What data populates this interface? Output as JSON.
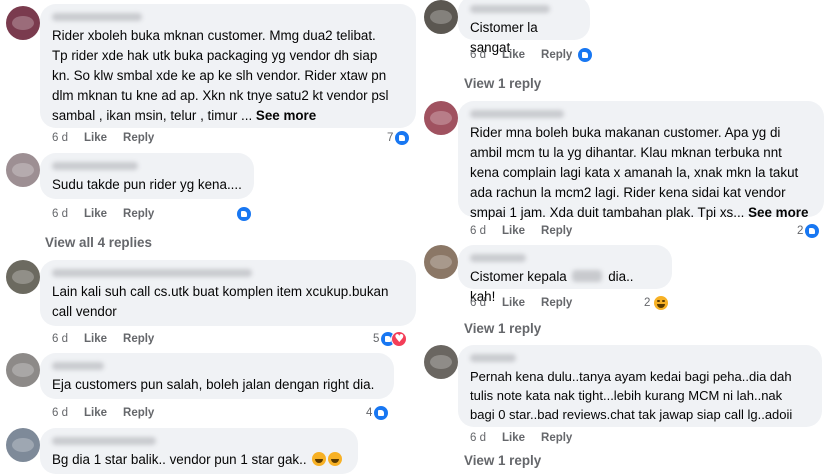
{
  "actions": {
    "time": "6 d",
    "like": "Like",
    "reply": "Reply"
  },
  "left": {
    "c1": {
      "lines": [
        "Rider xboleh buka mknan customer. Mmg dua2 telibat.",
        "Tp rider xde hak utk buka packaging yg vendor dh siap",
        "kn. So klw smbal xde ke ap ke slh vendor. Rider xtaw pn",
        "dlm mknan tu kne ad ap. Xkn nk tnye satu2 kt vendor psl"
      ],
      "last_line": "sambal , ikan msin, telur , timur ... ",
      "see_more": "See more",
      "reactions": "7"
    },
    "c2": {
      "text": "Sudu takde pun rider yg kena....",
      "reactions": ""
    },
    "view_replies": "View all 4 replies",
    "c3": {
      "lines": [
        "Lain kali suh call cs.utk buat komplen item xcukup.bukan",
        "call vendor"
      ],
      "reactions": "5"
    },
    "c4": {
      "text": "Eja customers pun salah, boleh jalan dengan right dia.",
      "reactions": "4"
    },
    "c5": {
      "text": "Bg dia 1 star balik.. vendor pun 1 star gak.."
    }
  },
  "right": {
    "c1": {
      "text": "Cistomer la sangat"
    },
    "view_reply_1": "View 1 reply",
    "c2": {
      "lines": [
        "Rider mna boleh buka makanan customer. Apa yg di",
        "ambil mcm tu la yg dihantar. Klau mknan terbuka nnt",
        "kena complain lagi kata x amanah la, xnak mkn la takut",
        "ada rachun la mcm2 lagi. Rider kena sidai kat vendor"
      ],
      "last_line": "smpai 1 jam. Xda duit tambahan plak. Tpi xs... ",
      "see_more": "See more",
      "reactions": "2"
    },
    "c3": {
      "text_before": "Cistomer kepala",
      "text_after": "dia.. kah!",
      "reactions": "2"
    },
    "view_reply_2": "View 1 reply",
    "c4": {
      "lines": [
        "Pernah kena dulu..tanya ayam kedai bagi peha..dia dah",
        "tulis note kata nak tight...lebih kurang MCM ni lah..nak",
        "bagi 0 star..bad reviews.chat tak jawap siap call lg..adoii"
      ]
    },
    "view_reply_3": "View 1 reply"
  },
  "colors": {
    "bubble": "#f0f2f5",
    "muted": "#65676b",
    "like_blue": "#1877f2"
  }
}
